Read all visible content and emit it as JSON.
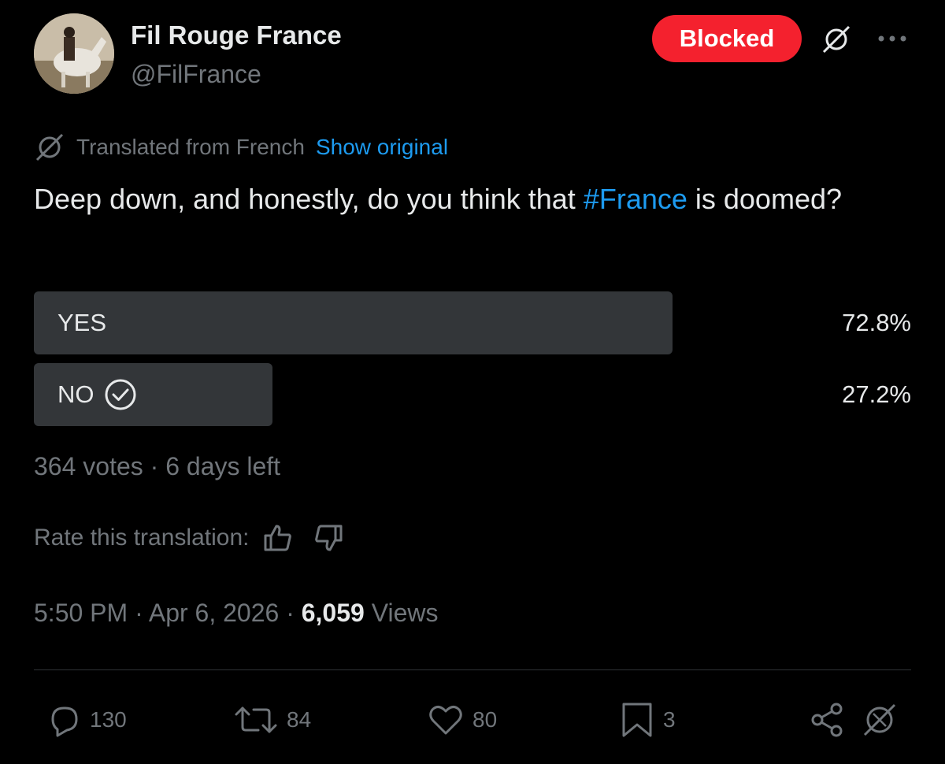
{
  "author": {
    "name": "Fil Rouge France",
    "handle": "@FilFrance",
    "blocked_label": "Blocked"
  },
  "icons": {
    "translate": "grok-translate-icon",
    "more": "more-options-icon",
    "reply": "reply-icon",
    "repost": "repost-icon",
    "like": "like-icon",
    "bookmark": "bookmark-icon",
    "share": "share-icon",
    "grok": "grok-icon"
  },
  "translation": {
    "notice": "Translated from French",
    "show_original": "Show original",
    "rate_label": "Rate this translation:"
  },
  "tweet": {
    "text_before": "Deep down, and honestly, do you think that ",
    "hashtag": "#France",
    "text_after": " is doomed?"
  },
  "poll": {
    "options": [
      {
        "label": "YES",
        "percent": "72.8%",
        "fraction": 0.728,
        "selected": false
      },
      {
        "label": "NO",
        "percent": "27.2%",
        "fraction": 0.272,
        "selected": true
      }
    ],
    "votes": "364 votes",
    "separator": " · ",
    "time_left": "6 days left"
  },
  "meta": {
    "time": "5:50 PM",
    "date": "Apr 6, 2026",
    "views_count": "6,059",
    "views_label": "Views",
    "separator": " · "
  },
  "actions": {
    "replies": "130",
    "reposts": "84",
    "likes": "80",
    "bookmarks": "3"
  },
  "colors": {
    "background": "#000000",
    "accent": "#1d9bf0",
    "blocked": "#f4212e",
    "muted": "#71767b",
    "poll_bar": "#333639"
  }
}
